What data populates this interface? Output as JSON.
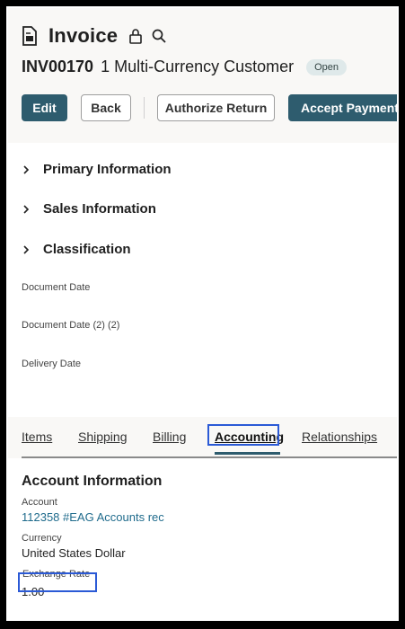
{
  "header": {
    "title": "Invoice",
    "invoice_number": "INV00170",
    "customer_name": "1 Multi-Currency Customer",
    "status": "Open"
  },
  "buttons": {
    "edit": "Edit",
    "back": "Back",
    "authorize_return": "Authorize Return",
    "accept_payment": "Accept Payment"
  },
  "sections": {
    "primary": "Primary Information",
    "sales": "Sales Information",
    "classification": "Classification"
  },
  "fields": {
    "document_date": "Document Date",
    "document_date_2": "Document Date (2) (2)",
    "delivery_date": "Delivery Date"
  },
  "tabs": {
    "items": "Items",
    "shipping": "Shipping",
    "billing": "Billing",
    "accounting": "Accounting",
    "relationships": "Relationships"
  },
  "account_info": {
    "heading": "Account Information",
    "account_label": "Account",
    "account_value": "112358 #EAG Accounts rec",
    "currency_label": "Currency",
    "currency_value": "United States Dollar",
    "exchange_rate_label": "Exchange Rate",
    "exchange_rate_value": "1.00"
  },
  "colors": {
    "primary_button": "#2e5c6e",
    "link": "#1f6b8c",
    "highlight": "#2b5ad6"
  }
}
